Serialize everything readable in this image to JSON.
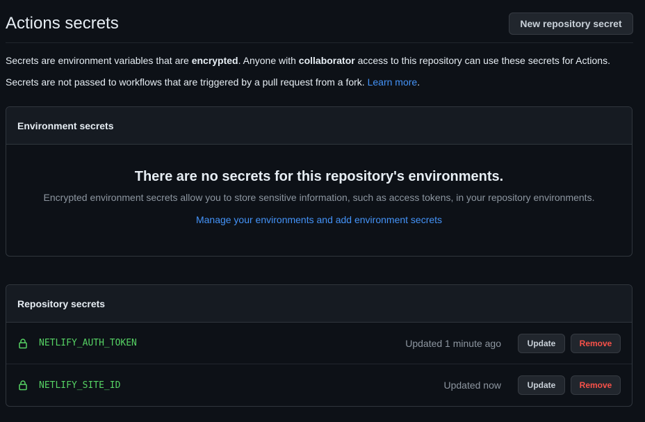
{
  "header": {
    "title": "Actions secrets",
    "new_secret_label": "New repository secret"
  },
  "description": {
    "line1": {
      "part1": "Secrets are environment variables that are ",
      "bold1": "encrypted",
      "part2": ". Anyone with ",
      "bold2": "collaborator",
      "part3": " access to this repository can use these secrets for Actions."
    },
    "line2": {
      "text": "Secrets are not passed to workflows that are triggered by a pull request from a fork. ",
      "link": "Learn more",
      "end": "."
    }
  },
  "environment_secrets": {
    "header": "Environment secrets",
    "empty_title": "There are no secrets for this repository's environments.",
    "empty_description": "Encrypted environment secrets allow you to store sensitive information, such as access tokens, in your repository environments.",
    "manage_link": "Manage your environments and add environment secrets"
  },
  "repository_secrets": {
    "header": "Repository secrets",
    "items": [
      {
        "icon": "lock-icon",
        "name": "NETLIFY_AUTH_TOKEN",
        "updated": "Updated 1 minute ago",
        "update_label": "Update",
        "remove_label": "Remove"
      },
      {
        "icon": "lock-icon",
        "name": "NETLIFY_SITE_ID",
        "updated": "Updated now",
        "update_label": "Update",
        "remove_label": "Remove"
      }
    ]
  },
  "colors": {
    "background": "#0d1117",
    "link": "#4493f8",
    "secret_name": "#56d364",
    "danger": "#f85149"
  }
}
